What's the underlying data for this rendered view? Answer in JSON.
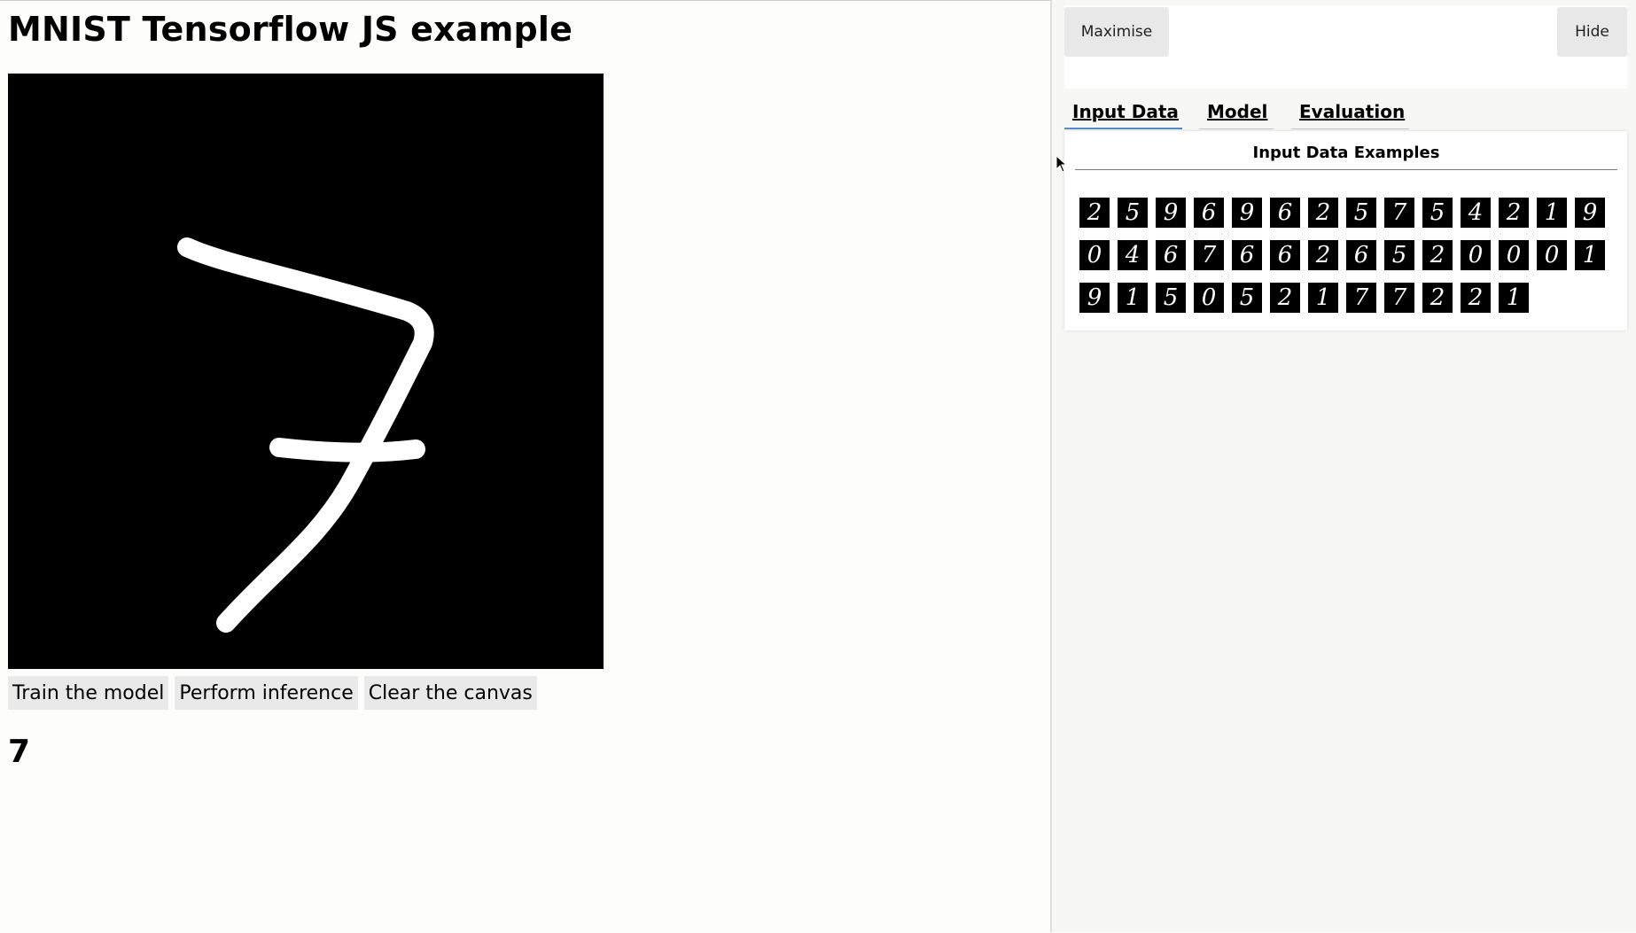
{
  "page": {
    "title": "MNIST Tensorflow JS example",
    "buttons": {
      "train": "Train the model",
      "infer": "Perform inference",
      "clear": "Clear the canvas"
    },
    "prediction": "7",
    "canvas": {
      "background": "#000000",
      "stroke_color": "#ffffff",
      "drawn_digit": "7"
    }
  },
  "visor": {
    "maximise_label": "Maximise",
    "hide_label": "Hide",
    "tabs": [
      {
        "label": "Input Data",
        "active": true
      },
      {
        "label": "Model",
        "active": false
      },
      {
        "label": "Evaluation",
        "active": false
      }
    ],
    "surface": {
      "title": "Input Data Examples",
      "examples": [
        "2",
        "5",
        "9",
        "6",
        "9",
        "6",
        "2",
        "5",
        "7",
        "5",
        "4",
        "2",
        "1",
        "9",
        "0",
        "4",
        "6",
        "7",
        "6",
        "6",
        "2",
        "6",
        "5",
        "2",
        "0",
        "0",
        "0",
        "1",
        "9",
        "1",
        "5",
        "0",
        "5",
        "2",
        "1",
        "7",
        "7",
        "2",
        "2",
        "1"
      ]
    }
  },
  "colors": {
    "accent": "#4a7fd0",
    "panel_bg": "#f7f7f5",
    "button_bg": "#e9e9e9"
  }
}
